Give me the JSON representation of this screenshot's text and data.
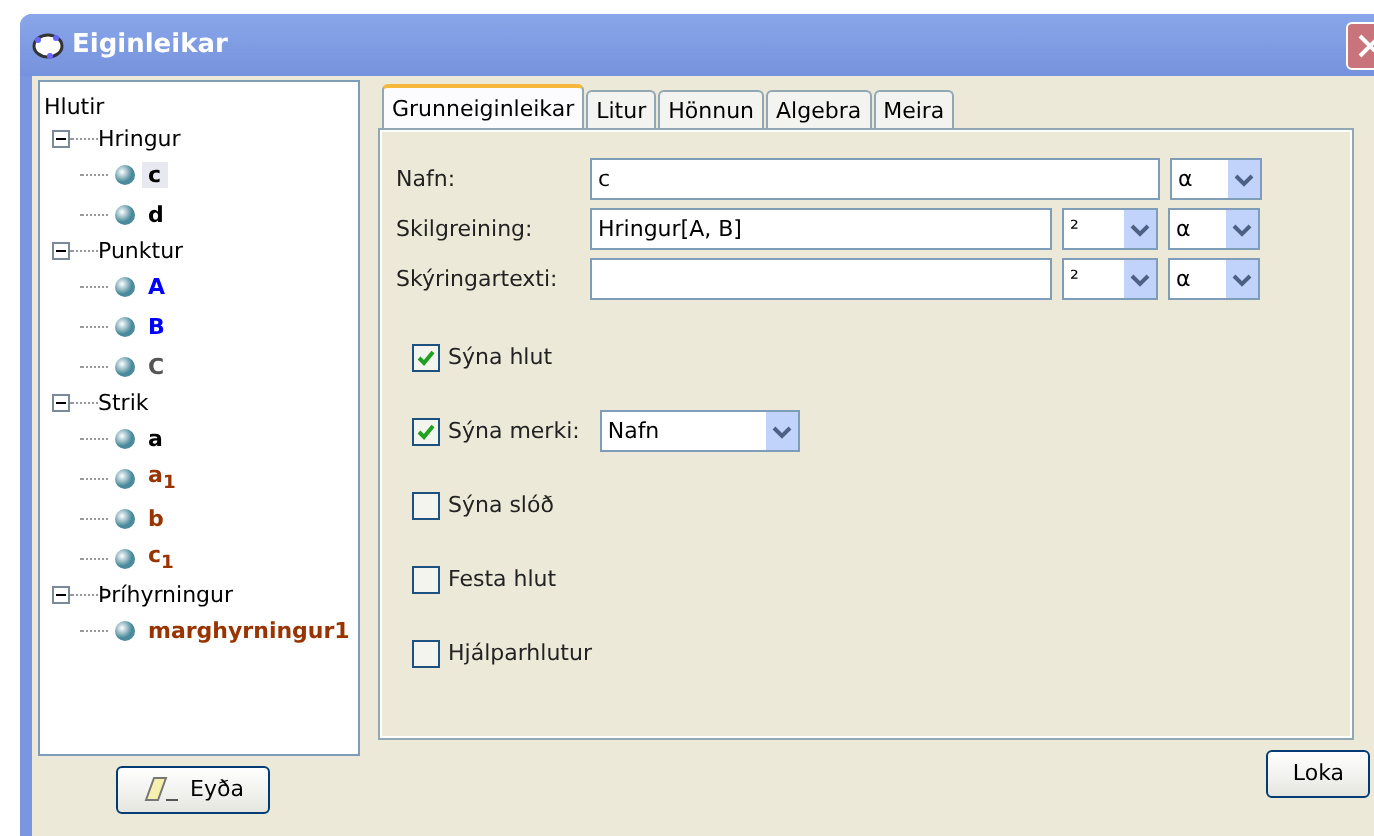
{
  "window": {
    "title": "Eiginleikar"
  },
  "tree": {
    "root": "Hlutir",
    "groups": [
      {
        "label": "Hringur",
        "expanded": true,
        "children": [
          {
            "label": "c",
            "color": "#000000",
            "selected": true
          },
          {
            "label": "d",
            "color": "#000000",
            "selected": false
          }
        ]
      },
      {
        "label": "Punktur",
        "expanded": true,
        "children": [
          {
            "label": "A",
            "color": "#0000ff",
            "selected": false
          },
          {
            "label": "B",
            "color": "#0000ff",
            "selected": false
          },
          {
            "label": "C",
            "color": "#555555",
            "selected": false
          }
        ]
      },
      {
        "label": "Strik",
        "expanded": true,
        "children": [
          {
            "label": "a",
            "color": "#000000",
            "selected": false
          },
          {
            "label": "a$_{1}$",
            "color": "#993300",
            "selected": false
          },
          {
            "label": "b",
            "color": "#993300",
            "selected": false
          },
          {
            "label": "c$_{1}$",
            "color": "#993300",
            "selected": false
          }
        ]
      },
      {
        "label": "Þríhyrningur",
        "expanded": true,
        "children": [
          {
            "label": "marghyrningur1",
            "color": "#993300",
            "selected": false
          }
        ]
      }
    ]
  },
  "tabs": [
    {
      "label": "Grunneiginleikar",
      "selected": true
    },
    {
      "label": "Litur",
      "selected": false
    },
    {
      "label": "Hönnun",
      "selected": false
    },
    {
      "label": "Algebra",
      "selected": false
    },
    {
      "label": "Meira",
      "selected": false
    }
  ],
  "fields": [
    {
      "label": "Nafn:",
      "value": "c",
      "symbol_menu": "α"
    },
    {
      "label": "Skilgreining:",
      "value": "Hringur[A, B]",
      "format_menu": "²",
      "symbol_menu": "α"
    },
    {
      "label": "Skýringartexti:",
      "format_menu": "²",
      "symbol_menu": "α"
    }
  ],
  "options": [
    {
      "label": "Sýna hlut",
      "checked": true
    },
    {
      "label": "Sýna merki:",
      "checked": true,
      "dropdown": "Nafn"
    },
    {
      "label": "Sýna slóð",
      "checked": false
    },
    {
      "label": "Festa hlut",
      "checked": false
    },
    {
      "label": "Hjálparhlutur",
      "checked": false
    }
  ],
  "buttons": {
    "delete": "Eyða",
    "close": "Loka"
  }
}
